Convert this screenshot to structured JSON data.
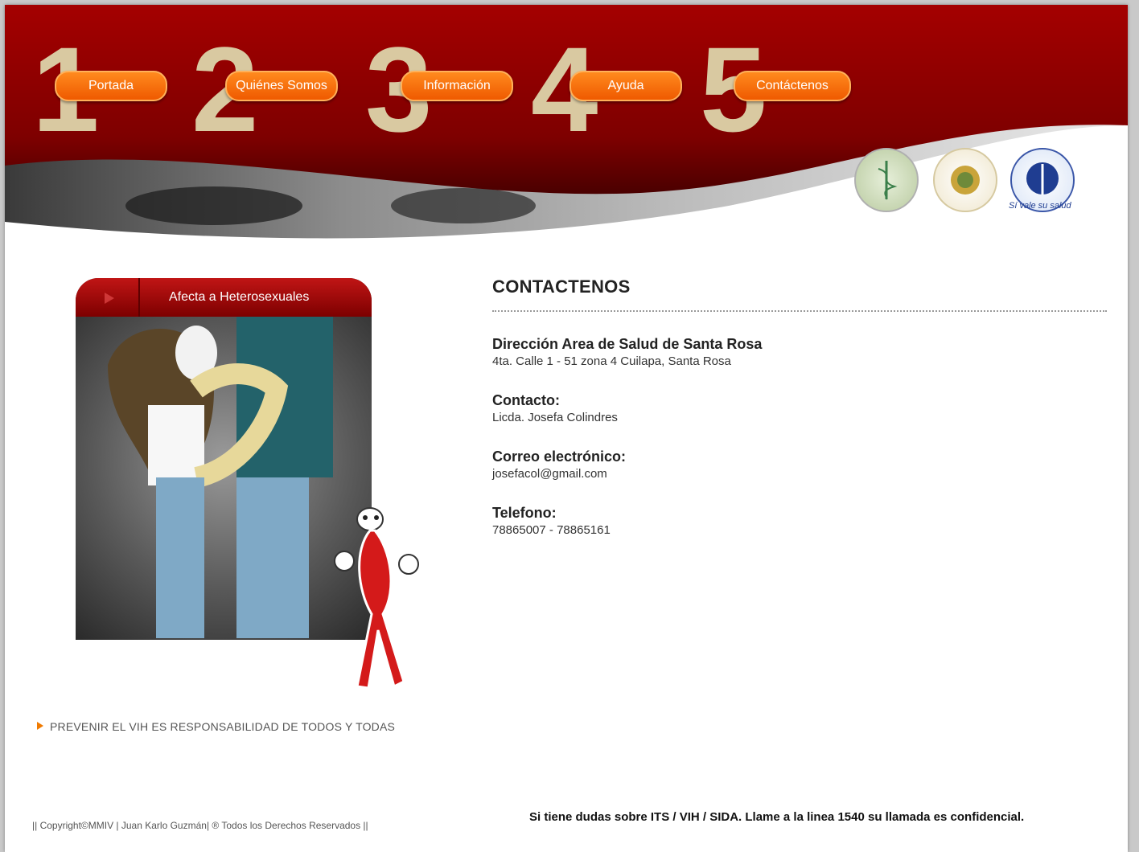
{
  "nav": {
    "items": [
      {
        "number": "1",
        "label": "Portada"
      },
      {
        "number": "2",
        "label": "Quiénes Somos"
      },
      {
        "number": "3",
        "label": "Información"
      },
      {
        "number": "4",
        "label": "Ayuda"
      },
      {
        "number": "5",
        "label": "Contáctenos"
      }
    ]
  },
  "logos": [
    "health-seal-logo",
    "government-seal-logo",
    "ministry-of-health-logo"
  ],
  "ministry_logo_text": "Sí vale su salud",
  "sidebar": {
    "card_title": "Afecta a Heterosexuales",
    "slogan": "PREVENIR EL VIH ES RESPONSABILIDAD DE TODOS Y TODAS"
  },
  "content": {
    "title": "CONTACTENOS",
    "items": [
      {
        "label": "Dirección Area de Salud de Santa Rosa",
        "value": "4ta. Calle 1 - 51 zona 4 Cuilapa, Santa Rosa"
      },
      {
        "label": "Contacto:",
        "value": "Licda. Josefa Colindres"
      },
      {
        "label": "Correo electrónico:",
        "value": "josefacol@gmail.com"
      },
      {
        "label": "Telefono:",
        "value": "78865007 - 78865161"
      }
    ]
  },
  "footer": {
    "copyright": "|| Copyright©MMIV | Juan Karlo Guzmán| ® Todos los Derechos Reservados ||",
    "hotline": "Si tiene dudas sobre ITS / VIH / SIDA. Llame a la linea 1540 su llamada es confidencial."
  },
  "colors": {
    "header_red": "#a30000",
    "button_orange": "#f26a00",
    "numeral_beige": "#d9c9a1"
  }
}
